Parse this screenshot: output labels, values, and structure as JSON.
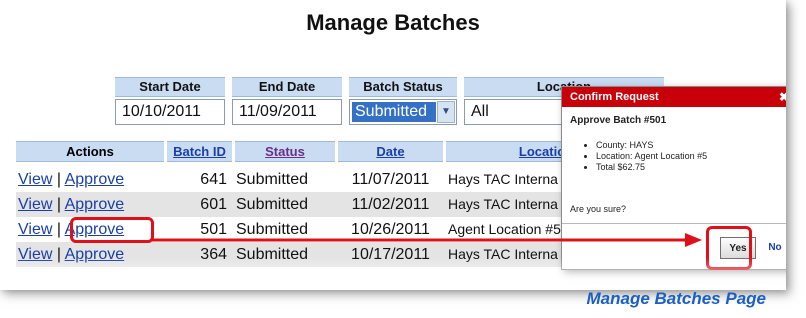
{
  "page_title": "Manage Batches",
  "filters": {
    "headers": [
      "Start Date",
      "End Date",
      "Batch Status",
      "Location"
    ],
    "start_date": "10/10/2011",
    "end_date": "11/09/2011",
    "batch_status": "Submitted",
    "location": "All"
  },
  "table": {
    "columns": [
      "Actions",
      "Batch ID",
      "Status",
      "Date",
      "Location"
    ],
    "view_label": "View",
    "separator": "|",
    "approve_label": "Approve",
    "rows": [
      {
        "batch_id": "641",
        "status": "Submitted",
        "date": "11/07/2011",
        "location": "Hays TAC Interna"
      },
      {
        "batch_id": "601",
        "status": "Submitted",
        "date": "11/02/2011",
        "location": "Hays TAC Interna"
      },
      {
        "batch_id": "501",
        "status": "Submitted",
        "date": "10/26/2011",
        "location": "Agent Location #5"
      },
      {
        "batch_id": "364",
        "status": "Submitted",
        "date": "10/17/2011",
        "location": "Hays TAC Interna"
      }
    ]
  },
  "dialog": {
    "title": "Confirm Request",
    "close_glyph": "✖",
    "heading": "Approve Batch #501",
    "details": [
      "County: HAYS",
      "Location: Agent Location #5",
      "Total $62.75"
    ],
    "question": "Are you sure?",
    "yes_label": "Yes",
    "no_label": "No"
  },
  "caption": "Manage Batches Page",
  "colors": {
    "header_bg": "#c9dcf2",
    "link": "#1a3fa8",
    "dialog_header": "#c8000a",
    "highlight": "#e0101a",
    "caption": "#1a5fc5"
  }
}
